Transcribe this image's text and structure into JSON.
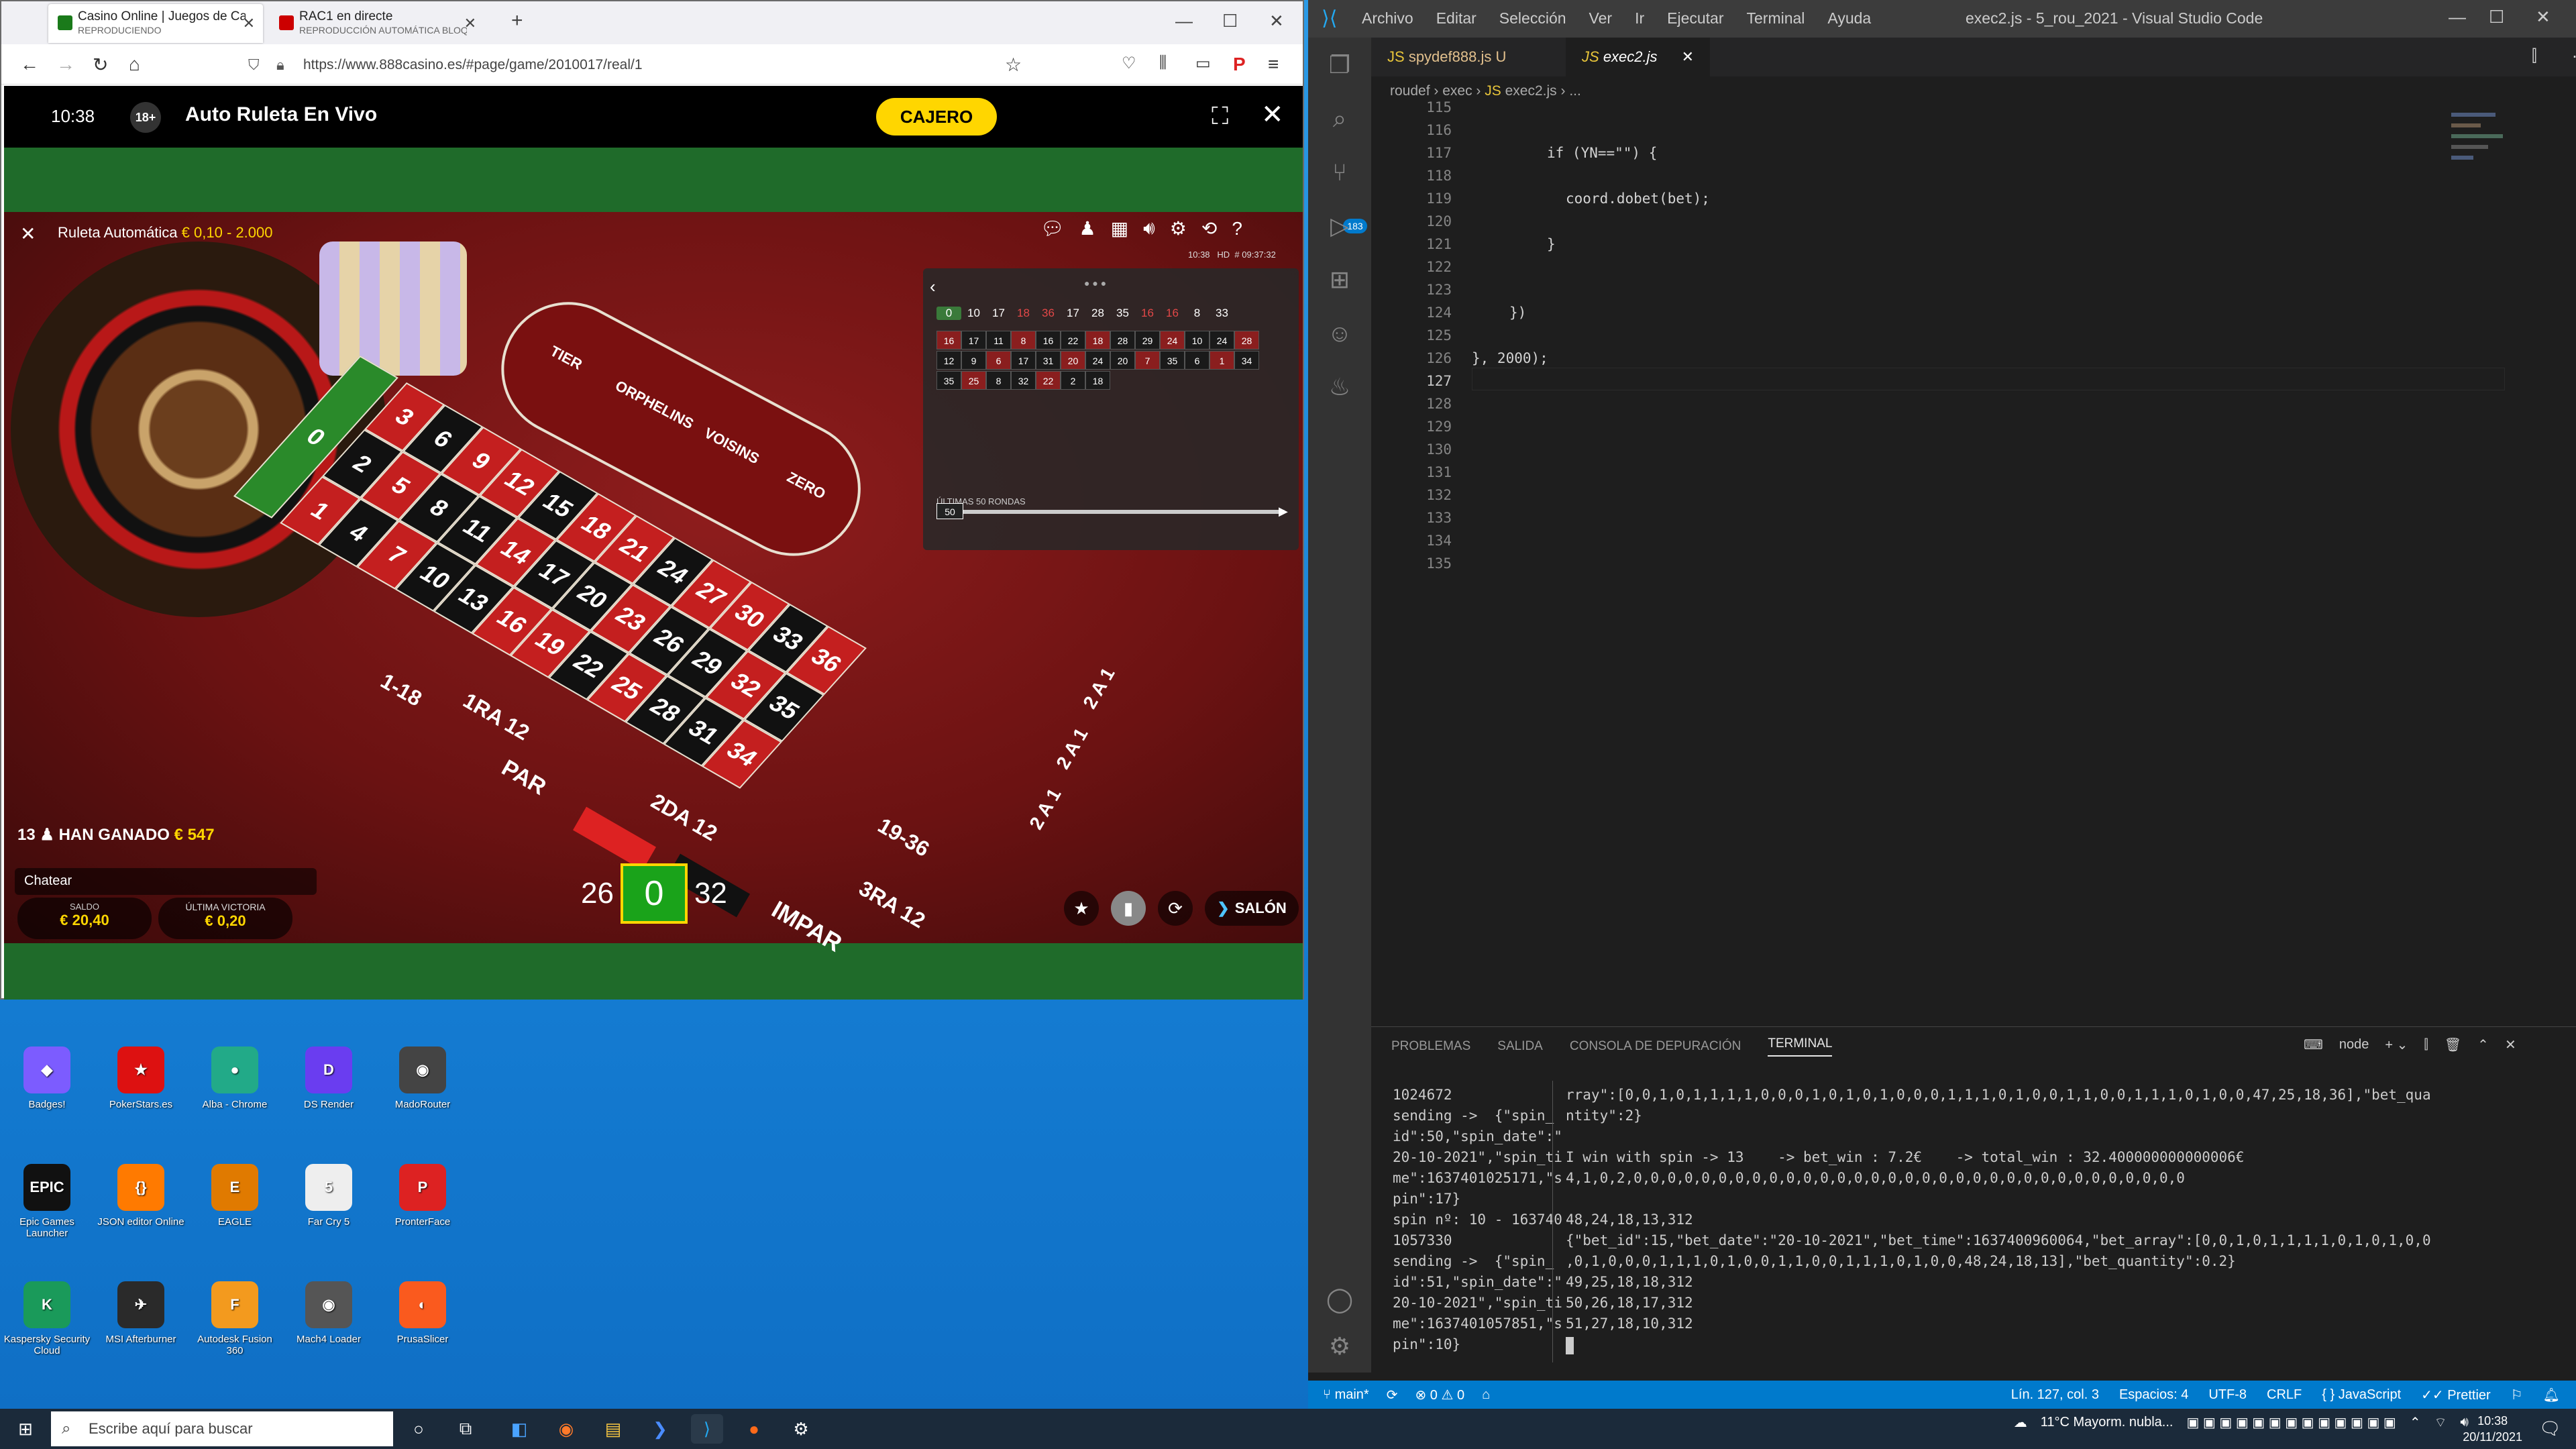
{
  "firefox": {
    "tabs": [
      {
        "title": "Casino Online | Juegos de Casin",
        "subtitle": "REPRODUCIENDO"
      },
      {
        "title": "RAC1 en directe",
        "subtitle": "REPRODUCCIÓN AUTOMÁTICA BLOQU"
      }
    ],
    "url": "https://www.888casino.es/#page/game/2010017/real/1",
    "win_min": "—",
    "win_max": "☐",
    "win_close": "✕",
    "new_tab": "+"
  },
  "casino": {
    "time": "10:38",
    "age": "18+",
    "title": "Auto Ruleta En Vivo",
    "cashier": "CAJERO",
    "overlay_title": "Ruleta Automática",
    "limits": "€ 0,10 - 2.000",
    "hd": "HD",
    "session_time": "10:38",
    "round_id": "# 09:37:32",
    "history_rows": [
      [
        "0",
        "10",
        "17",
        "18",
        "36",
        "17",
        "28",
        "35",
        "16",
        "16",
        "8",
        "33"
      ]
    ],
    "history_red_idx": [
      3,
      4,
      8,
      9
    ],
    "history_grid": [
      [
        "16",
        "17",
        "11",
        "8",
        "16",
        "22",
        "18",
        "28",
        "29",
        "24",
        "10",
        "24",
        "28"
      ],
      [
        "12",
        "9",
        "6",
        "17",
        "31",
        "20",
        "24",
        "20",
        "7",
        "35",
        "6",
        "1",
        "34"
      ],
      [
        "35",
        "25",
        "8",
        "32",
        "22",
        "2",
        "18"
      ]
    ],
    "last_rounds_label": "ÚLTIMAS 50 RONDAS",
    "slider_value": "50",
    "racetrack": {
      "tier": "TIER",
      "orphelins": "ORPHELINS",
      "voisins": "VOISINS",
      "zero": "ZERO"
    },
    "winners": "13",
    "won_label": "HAN GANADO",
    "won_amount": "€ 547",
    "chat": "Chatear",
    "balance_label": "SALDO",
    "balance": "€ 20,40",
    "last_win_label": "ÚLTIMA VICTORIA",
    "last_win": "€ 0,20",
    "result_prev": "26",
    "result": "0",
    "result_next": "32",
    "salon": "SALÓN",
    "bets": {
      "low": "1-18",
      "even": "PAR",
      "first": "1RA 12",
      "second": "2DA 12",
      "third": "3RA 12",
      "odd": "IMPAR",
      "high": "19-36",
      "col": "2 A 1"
    }
  },
  "desktop_icons": [
    {
      "label": "Badges!",
      "color": "#7c5cff",
      "glyph": "◆"
    },
    {
      "label": "PokerStars.es",
      "color": "#d11",
      "glyph": "★"
    },
    {
      "label": "Alba - Chrome",
      "color": "#2a8",
      "glyph": "●"
    },
    {
      "label": "DS Render",
      "color": "#6a3df0",
      "glyph": "D"
    },
    {
      "label": "MadoRouter",
      "color": "#444",
      "glyph": "◉"
    },
    {
      "label": "Epic Games Launcher",
      "color": "#111",
      "glyph": "EPIC"
    },
    {
      "label": "JSON editor Online",
      "color": "#ff7a00",
      "glyph": "{}"
    },
    {
      "label": "EAGLE",
      "color": "#e07a00",
      "glyph": "E"
    },
    {
      "label": "Far Cry 5",
      "color": "#eee",
      "glyph": "5"
    },
    {
      "label": "PronterFace",
      "color": "#d22",
      "glyph": "P"
    },
    {
      "label": "Kaspersky Security Cloud",
      "color": "#1a9a5a",
      "glyph": "K"
    },
    {
      "label": "MSI Afterburner",
      "color": "#2a2a2a",
      "glyph": "✈"
    },
    {
      "label": "Autodesk Fusion 360",
      "color": "#f39a1e",
      "glyph": "F"
    },
    {
      "label": "Mach4 Loader",
      "color": "#555",
      "glyph": "◉"
    },
    {
      "label": "PrusaSlicer",
      "color": "#fa5a1e",
      "glyph": "◐"
    }
  ],
  "vscode": {
    "menu": [
      "Archivo",
      "Editar",
      "Selección",
      "Ver",
      "Ir",
      "Ejecutar",
      "Terminal",
      "Ayuda"
    ],
    "caption": "exec2.js - 5_rou_2021 - Visual Studio Code",
    "tabs": [
      {
        "label": "spydef888.js",
        "flag": "U"
      },
      {
        "label": "exec2.js",
        "flag": "✕"
      }
    ],
    "breadcrumb": [
      "roudef",
      "exec",
      "exec2.js",
      "..."
    ],
    "source_control_badge": "183",
    "lines": [
      {
        "n": "115",
        "code": ""
      },
      {
        "n": "116",
        "code": ""
      },
      {
        "n": "117",
        "code": "if (YN==\"\") {"
      },
      {
        "n": "118",
        "code": ""
      },
      {
        "n": "119",
        "code": "coord.dobet(bet);"
      },
      {
        "n": "120",
        "code": ""
      },
      {
        "n": "121",
        "code": "}"
      },
      {
        "n": "122",
        "code": ""
      },
      {
        "n": "123",
        "code": ""
      },
      {
        "n": "124",
        "code": "})"
      },
      {
        "n": "125",
        "code": ""
      },
      {
        "n": "126",
        "code": "}, 2000);"
      },
      {
        "n": "127",
        "code": ""
      },
      {
        "n": "128",
        "code": ""
      },
      {
        "n": "129",
        "code": ""
      },
      {
        "n": "130",
        "code": ""
      },
      {
        "n": "131",
        "code": ""
      },
      {
        "n": "132",
        "code": ""
      },
      {
        "n": "133",
        "code": ""
      },
      {
        "n": "134",
        "code": ""
      },
      {
        "n": "135",
        "code": ""
      }
    ],
    "panel_tabs": [
      "PROBLEMAS",
      "SALIDA",
      "CONSOLA DE DEPURACIÓN",
      "TERMINAL"
    ],
    "shell": "node",
    "term_left": "1024672\nsending ->  {\"spin_\nid\":50,\"spin_date\":\"\n20-10-2021\",\"spin_ti\nme\":1637401025171,\"s\npin\":17}\nspin nº: 10 - 163740\n1057330\nsending ->  {\"spin_\nid\":51,\"spin_date\":\"\n20-10-2021\",\"spin_ti\nme\":1637401057851,\"s\npin\":10}",
    "term_right": "rray\":[0,0,1,0,1,1,1,1,0,0,0,1,0,1,0,1,0,0,0,1,1,1,0,1,0,0,1,1,0,0,1,1,1,0,1,0,0,47,25,18,36],\"bet_qua\nntity\":2}\n\nI win with spin -> 13    -> bet_win : 7.2€    -> total_win : 32.400000000000006€\n4,1,0,2,0,0,0,0,0,0,0,0,0,0,0,0,0,0,0,0,0,0,0,0,0,0,0,0,0,0,0,0,0,0,0,0,0\n\n48,24,18,13,312\n{\"bet_id\":15,\"bet_date\":\"20-10-2021\",\"bet_time\":1637400960064,\"bet_array\":[0,0,1,0,1,1,1,1,0,1,0,1,0,0\n,0,1,0,0,0,1,1,1,0,1,0,0,1,1,0,0,1,1,1,0,1,0,0,48,24,18,13],\"bet_quantity\":0.2}\n49,25,18,18,312\n50,26,18,17,312\n51,27,18,10,312",
    "status": {
      "branch": "main*",
      "errors": "0",
      "warnings": "0",
      "position": "Lín. 127, col. 3",
      "spaces": "Espacios: 4",
      "encoding": "UTF-8",
      "eol": "CRLF",
      "language": "JavaScript",
      "prettier": "Prettier"
    }
  },
  "taskbar": {
    "search_placeholder": "Escribe aquí para buscar",
    "weather": "11°C  Mayorm. nubla...",
    "time": "10:38",
    "date": "20/11/2021"
  },
  "colors": {
    "accent": "#007acc",
    "cashier": "#ffd600",
    "red": "#c41f1f",
    "green": "#1aa31a"
  }
}
